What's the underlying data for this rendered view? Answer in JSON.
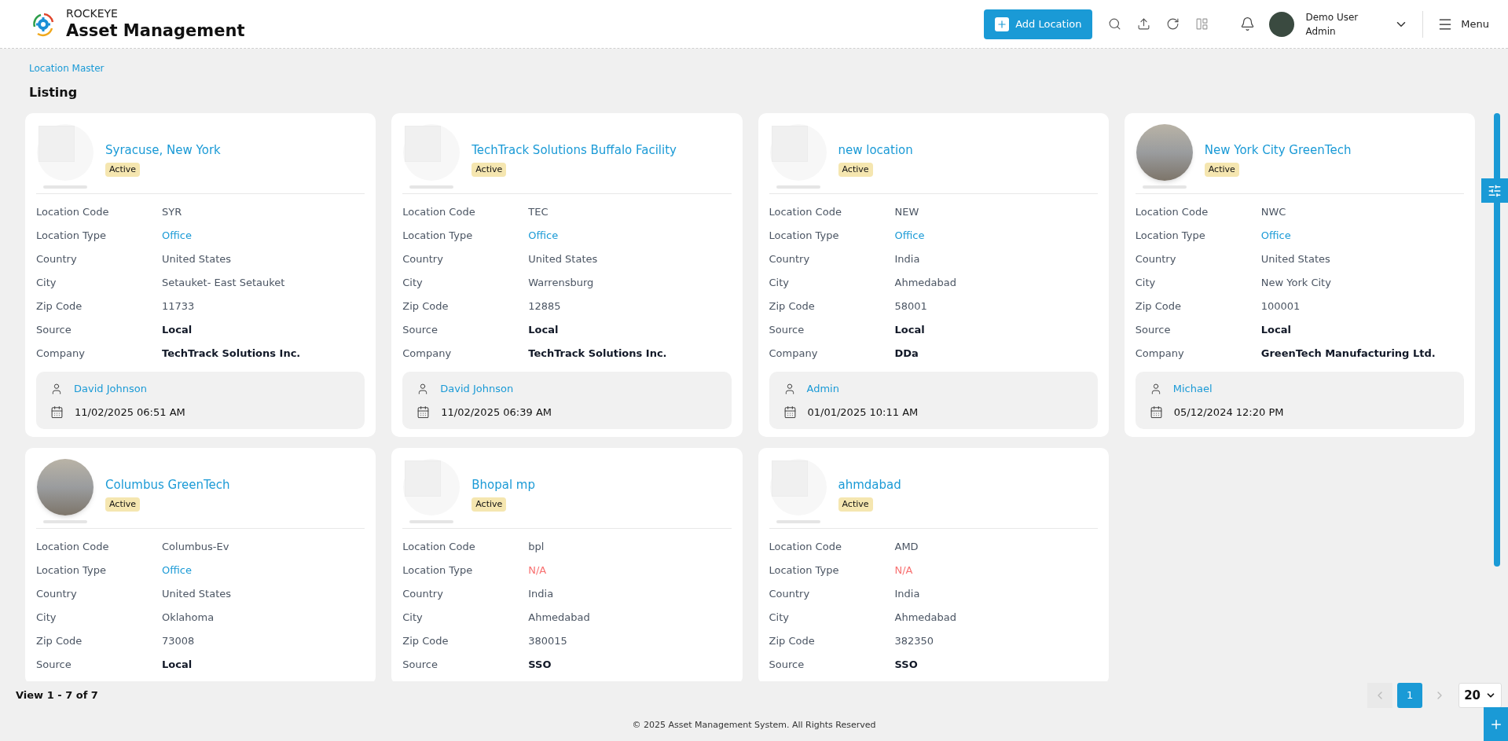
{
  "brand": {
    "company": "ROCKEYE",
    "product": "Asset Management"
  },
  "header": {
    "add_button": "Add Location",
    "user": {
      "name": "Demo User",
      "role": "Admin"
    },
    "menu": "Menu"
  },
  "breadcrumb": "Location Master",
  "page_title": "Listing",
  "cards": [
    {
      "name": "Syracuse, New York",
      "status": "Active",
      "kind": "no_image",
      "fields": [
        {
          "label": "Location Code",
          "value": "SYR",
          "kind": "plain"
        },
        {
          "label": "Location Type",
          "value": "Office",
          "kind": "link"
        },
        {
          "label": "Country",
          "value": "United States",
          "kind": "plain"
        },
        {
          "label": "City",
          "value": "Setauket- East Setauket",
          "kind": "plain"
        },
        {
          "label": "Zip Code",
          "value": "11733",
          "kind": "plain"
        },
        {
          "label": "Source",
          "value": "Local",
          "kind": "strong"
        },
        {
          "label": "Company",
          "value": "TechTrack Solutions Inc.",
          "kind": "strong"
        }
      ],
      "user": "David Johnson",
      "datetime": "11/02/2025 06:51 AM"
    },
    {
      "name": "TechTrack Solutions Buffalo Facility",
      "status": "Active",
      "kind": "no_image",
      "fields": [
        {
          "label": "Location Code",
          "value": "TEC",
          "kind": "plain"
        },
        {
          "label": "Location Type",
          "value": "Office",
          "kind": "link"
        },
        {
          "label": "Country",
          "value": "United States",
          "kind": "plain"
        },
        {
          "label": "City",
          "value": "Warrensburg",
          "kind": "plain"
        },
        {
          "label": "Zip Code",
          "value": "12885",
          "kind": "plain"
        },
        {
          "label": "Source",
          "value": "Local",
          "kind": "strong"
        },
        {
          "label": "Company",
          "value": "TechTrack Solutions Inc.",
          "kind": "strong"
        }
      ],
      "user": "David Johnson",
      "datetime": "11/02/2025 06:39 AM"
    },
    {
      "name": "new location",
      "status": "Active",
      "kind": "no_image",
      "fields": [
        {
          "label": "Location Code",
          "value": "NEW",
          "kind": "plain"
        },
        {
          "label": "Location Type",
          "value": "Office",
          "kind": "link"
        },
        {
          "label": "Country",
          "value": "India",
          "kind": "plain"
        },
        {
          "label": "City",
          "value": "Ahmedabad",
          "kind": "plain"
        },
        {
          "label": "Zip Code",
          "value": "58001",
          "kind": "plain"
        },
        {
          "label": "Source",
          "value": "Local",
          "kind": "strong"
        },
        {
          "label": "Company",
          "value": "DDa",
          "kind": "strong"
        }
      ],
      "user": "Admin",
      "datetime": "01/01/2025 10:11 AM"
    },
    {
      "name": "New York City GreenTech",
      "status": "Active",
      "kind": "photo",
      "fields": [
        {
          "label": "Location Code",
          "value": "NWC",
          "kind": "plain"
        },
        {
          "label": "Location Type",
          "value": "Office",
          "kind": "link"
        },
        {
          "label": "Country",
          "value": "United States",
          "kind": "plain"
        },
        {
          "label": "City",
          "value": "New York City",
          "kind": "plain"
        },
        {
          "label": "Zip Code",
          "value": "100001",
          "kind": "plain"
        },
        {
          "label": "Source",
          "value": "Local",
          "kind": "strong"
        },
        {
          "label": "Company",
          "value": "GreenTech Manufacturing Ltd.",
          "kind": "strong"
        }
      ],
      "user": "Michael",
      "datetime": "05/12/2024 12:20 PM"
    },
    {
      "name": "Columbus GreenTech",
      "status": "Active",
      "kind": "photo",
      "fields": [
        {
          "label": "Location Code",
          "value": "Columbus-Ev",
          "kind": "plain"
        },
        {
          "label": "Location Type",
          "value": "Office",
          "kind": "link"
        },
        {
          "label": "Country",
          "value": "United States",
          "kind": "plain"
        },
        {
          "label": "City",
          "value": "Oklahoma",
          "kind": "plain"
        },
        {
          "label": "Zip Code",
          "value": "73008",
          "kind": "plain"
        },
        {
          "label": "Source",
          "value": "Local",
          "kind": "strong"
        }
      ]
    },
    {
      "name": "Bhopal mp",
      "status": "Active",
      "kind": "no_image",
      "fields": [
        {
          "label": "Location Code",
          "value": "bpl",
          "kind": "plain"
        },
        {
          "label": "Location Type",
          "value": "N/A",
          "kind": "na"
        },
        {
          "label": "Country",
          "value": "India",
          "kind": "plain"
        },
        {
          "label": "City",
          "value": "Ahmedabad",
          "kind": "plain"
        },
        {
          "label": "Zip Code",
          "value": "380015",
          "kind": "plain"
        },
        {
          "label": "Source",
          "value": "SSO",
          "kind": "strong"
        }
      ]
    },
    {
      "name": "ahmdabad",
      "status": "Active",
      "kind": "no_image",
      "fields": [
        {
          "label": "Location Code",
          "value": "AMD",
          "kind": "plain"
        },
        {
          "label": "Location Type",
          "value": "N/A",
          "kind": "na"
        },
        {
          "label": "Country",
          "value": "India",
          "kind": "plain"
        },
        {
          "label": "City",
          "value": "Ahmedabad",
          "kind": "plain"
        },
        {
          "label": "Zip Code",
          "value": "382350",
          "kind": "plain"
        },
        {
          "label": "Source",
          "value": "SSO",
          "kind": "strong"
        }
      ]
    }
  ],
  "pagination": {
    "summary": "View 1 - 7 of 7",
    "pages": [
      {
        "label": "1",
        "selected": true
      }
    ],
    "page_size": "20"
  },
  "footer": "© 2025 Asset Management System. All Rights Reserved"
}
